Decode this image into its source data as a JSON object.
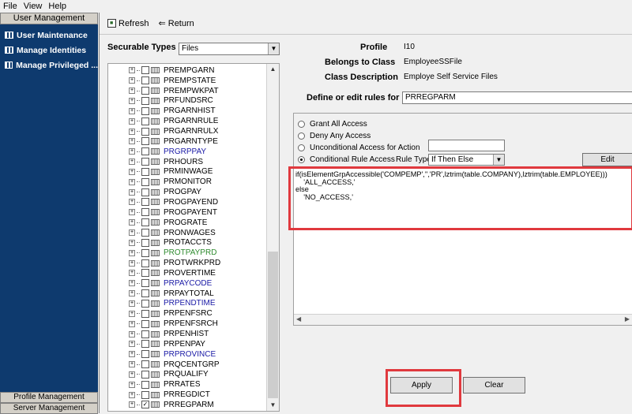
{
  "menu": [
    "File",
    "View",
    "Help"
  ],
  "sidebar": {
    "header": "User Management",
    "items": [
      {
        "label": "User Maintenance"
      },
      {
        "label": "Manage Identities"
      },
      {
        "label": "Manage Privileged ..."
      }
    ],
    "footer1": "Profile Management",
    "footer2": "Server Management"
  },
  "toolbar": {
    "refresh_label": "Refresh",
    "return_label": "Return"
  },
  "securable": {
    "label": "Securable Types",
    "selected": "Files"
  },
  "info": {
    "profile_label": "Profile",
    "profile_value": "I10",
    "class_label": "Belongs to Class",
    "class_value": "EmployeeSSFile",
    "desc_label": "Class Description",
    "desc_value": "Employe Self Service Files",
    "define_label": "Define or edit rules for",
    "define_value": "PRREGPARM"
  },
  "tree_items": [
    {
      "name": "PREMPGARN",
      "color": "#000000",
      "checked": false
    },
    {
      "name": "PREMPSTATE",
      "color": "#000000",
      "checked": false
    },
    {
      "name": "PREMPWKPAT",
      "color": "#000000",
      "checked": false
    },
    {
      "name": "PRFUNDSRC",
      "color": "#000000",
      "checked": false
    },
    {
      "name": "PRGARNHIST",
      "color": "#000000",
      "checked": false
    },
    {
      "name": "PRGARNRULE",
      "color": "#000000",
      "checked": false
    },
    {
      "name": "PRGARNRULX",
      "color": "#000000",
      "checked": false
    },
    {
      "name": "PRGARNTYPE",
      "color": "#000000",
      "checked": false
    },
    {
      "name": "PRGRPPAY",
      "color": "#1a1aa6",
      "checked": false
    },
    {
      "name": "PRHOURS",
      "color": "#000000",
      "checked": false
    },
    {
      "name": "PRMINWAGE",
      "color": "#000000",
      "checked": false
    },
    {
      "name": "PRMONITOR",
      "color": "#000000",
      "checked": false
    },
    {
      "name": "PROGPAY",
      "color": "#000000",
      "checked": false
    },
    {
      "name": "PROGPAYEND",
      "color": "#000000",
      "checked": false
    },
    {
      "name": "PROGPAYENT",
      "color": "#000000",
      "checked": false
    },
    {
      "name": "PROGRATE",
      "color": "#000000",
      "checked": false
    },
    {
      "name": "PRONWAGES",
      "color": "#000000",
      "checked": false
    },
    {
      "name": "PROTACCTS",
      "color": "#000000",
      "checked": false
    },
    {
      "name": "PROTPAYPRD",
      "color": "#2e8b2e",
      "checked": false
    },
    {
      "name": "PROTWRKPRD",
      "color": "#000000",
      "checked": false
    },
    {
      "name": "PROVERTIME",
      "color": "#000000",
      "checked": false
    },
    {
      "name": "PRPAYCODE",
      "color": "#1a1aa6",
      "checked": false
    },
    {
      "name": "PRPAYTOTAL",
      "color": "#000000",
      "checked": false
    },
    {
      "name": "PRPENDTIME",
      "color": "#1a1aa6",
      "checked": false
    },
    {
      "name": "PRPENFSRC",
      "color": "#000000",
      "checked": false
    },
    {
      "name": "PRPENFSRCH",
      "color": "#000000",
      "checked": false
    },
    {
      "name": "PRPENHIST",
      "color": "#000000",
      "checked": false
    },
    {
      "name": "PRPENPAY",
      "color": "#000000",
      "checked": false
    },
    {
      "name": "PRPROVINCE",
      "color": "#1a1aa6",
      "checked": false
    },
    {
      "name": "PRQCENTGRP",
      "color": "#000000",
      "checked": false
    },
    {
      "name": "PRQUALIFY",
      "color": "#000000",
      "checked": false
    },
    {
      "name": "PRRATES",
      "color": "#000000",
      "checked": false
    },
    {
      "name": "PRREGDICT",
      "color": "#000000",
      "checked": false
    },
    {
      "name": "PRREGPARM",
      "color": "#000000",
      "checked": true
    }
  ],
  "rules": {
    "grant_all": "Grant All Access",
    "deny_any": "Deny Any Access",
    "unconditional": "Unconditional Access for Action",
    "conditional": "Conditional Rule Access",
    "rule_type_label": "Rule Type",
    "rule_type_value": "If Then Else",
    "edit_label": "Edit",
    "code": "if(isElementGrpAccessible('COMPEMP','','PR',lztrim(table.COMPANY),lztrim(table.EMPLOYEE)))\n    'ALL_ACCESS,'\nelse\n    'NO_ACCESS,'"
  },
  "buttons": {
    "apply": "Apply",
    "clear": "Clear"
  },
  "colors": {
    "sidebar_bg": "#0e3a6e",
    "highlight": "#e0393e"
  }
}
